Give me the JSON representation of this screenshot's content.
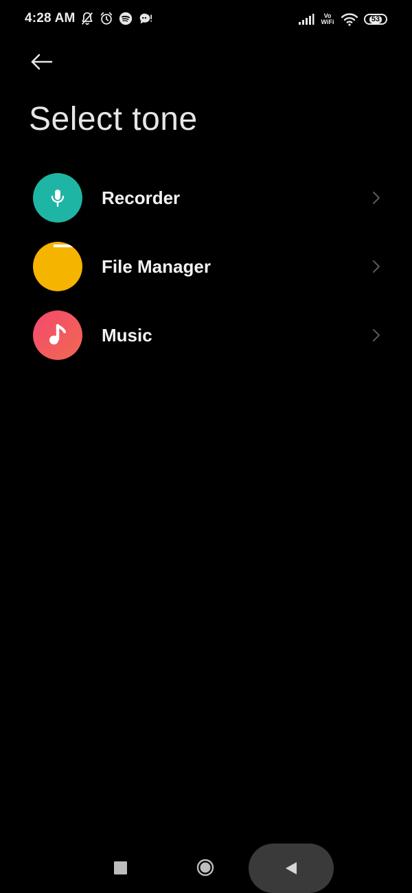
{
  "status_bar": {
    "time": "4:28 AM",
    "left_icons": [
      "bell-off-icon",
      "alarm-icon",
      "spotify-icon",
      "chat-bubble-icon"
    ],
    "vo_label": "Vo",
    "wifi_label": "WiFi",
    "battery_level": "53"
  },
  "header": {
    "back_icon": "arrow-left-icon",
    "title": "Select tone"
  },
  "tone_sources": [
    {
      "label": "Recorder",
      "icon": "microphone-icon",
      "color": "#1fb5a4"
    },
    {
      "label": "File Manager",
      "icon": "folder-icon",
      "color": "#f5b400"
    },
    {
      "label": "Music",
      "icon": "music-note-icon",
      "color": "#f0506a"
    }
  ],
  "nav_bar": {
    "recents_icon": "square-icon",
    "home_icon": "circle-icon",
    "back_icon": "triangle-left-icon"
  }
}
